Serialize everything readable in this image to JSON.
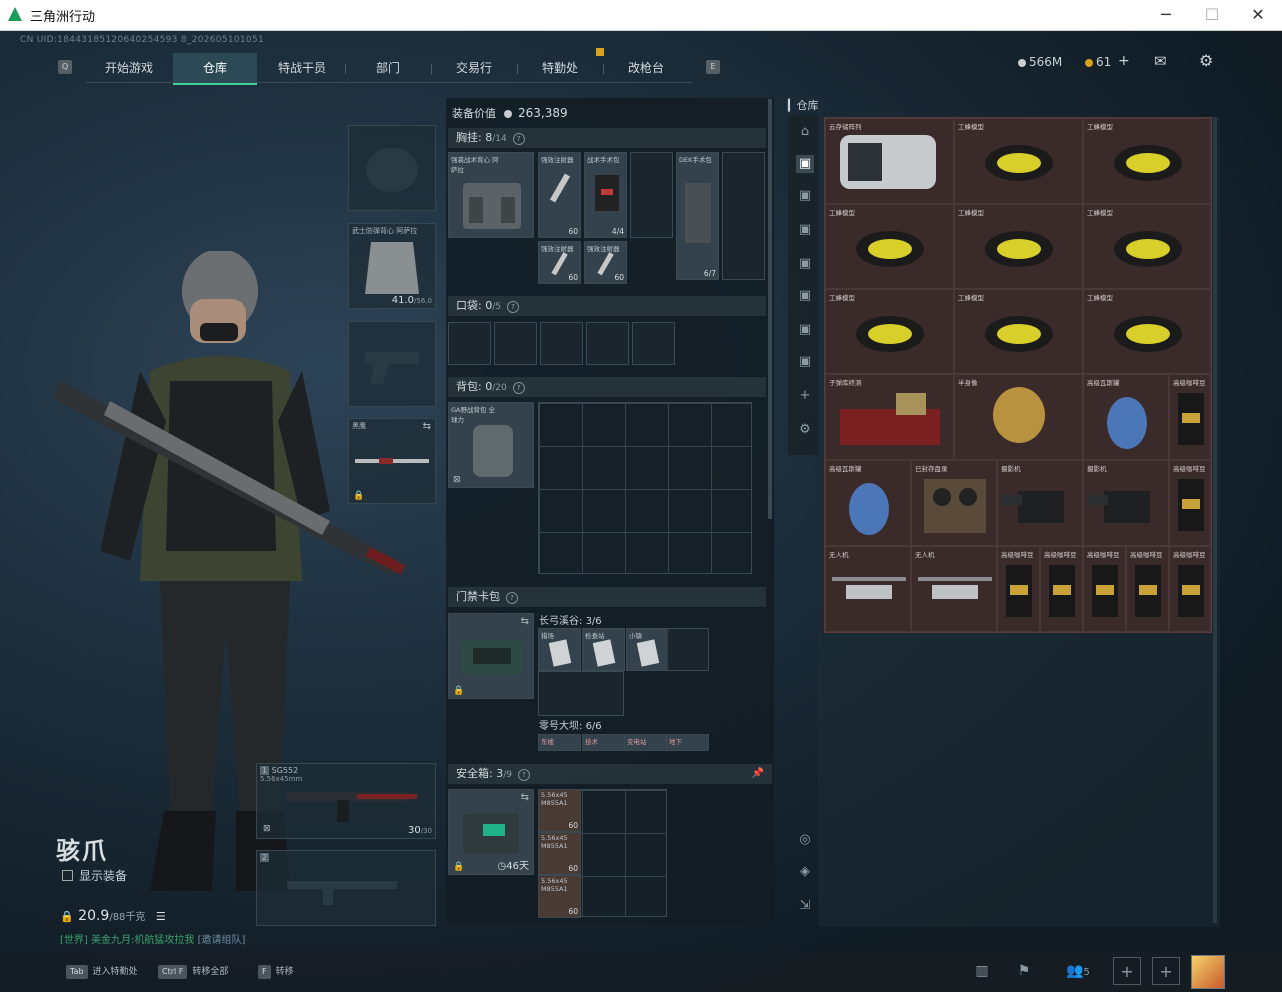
{
  "window": {
    "title": "三角洲行动",
    "minimize": "─",
    "maximize": "☐",
    "close": "✕"
  },
  "uid": "CN UID:18443185120640254593 8_202605101051",
  "nav": {
    "left_key": "Q",
    "right_key": "E",
    "tabs": [
      "开始游戏",
      "仓库",
      "特战干员",
      "部门",
      "交易行",
      "特勤处",
      "改枪台"
    ],
    "active_index": 1
  },
  "currency": {
    "silver": "566M",
    "gold": "61"
  },
  "character": {
    "name": "骇爪",
    "show_equipment": "显示装备",
    "weight": "20.9",
    "weight_max": "/88千克"
  },
  "chat": {
    "channel": "[世界]",
    "message": "美金九月:机航猛攻拉我",
    "invite": "[邀请组队]"
  },
  "slots": {
    "armor": {
      "label": "武士防弹背心 阿萨拉",
      "value": "41.0",
      "max": "/56.0"
    },
    "melee": {
      "label": "黑鹰"
    },
    "primary": {
      "index": "1",
      "name": "SG552",
      "caliber": "5.56x45mm",
      "ammo": "30",
      "ammo_max": "/30"
    },
    "secondary": {
      "index": "2"
    }
  },
  "equipment": {
    "value_label": "装备价值",
    "value": "263,389",
    "chest_rig": {
      "title": "胸挂:",
      "count": "8",
      "cap": "/14"
    },
    "chest_rig_item": "强袭战术背心 阿萨拉",
    "chest_items": [
      {
        "label": "强效注射器",
        "val": "60"
      },
      {
        "label": "战术手术包",
        "val": "4/4"
      },
      {
        "label": "DEK手术包",
        "val": "6/7"
      },
      {
        "label": "强效注射器",
        "val": "60"
      },
      {
        "label": "强效注射器",
        "val": "60"
      }
    ],
    "pocket": {
      "title": "口袋:",
      "count": "0",
      "cap": "/5"
    },
    "backpack": {
      "title": "背包:",
      "count": "0",
      "cap": "/20"
    },
    "backpack_item": "GA野战背包 全球力",
    "keycard": {
      "title": "门禁卡包"
    },
    "keycard_maps": [
      {
        "name": "长弓溪谷:",
        "count": "3/6",
        "cards": [
          "猎场",
          "检查站",
          "小镇"
        ]
      },
      {
        "name": "零号大坝:",
        "count": "6/6",
        "cards": [
          "东楼",
          "技术",
          "变电站",
          "地下"
        ]
      }
    ],
    "safe_box": {
      "title": "安全箱:",
      "count": "3",
      "cap": "/9",
      "days": "46天"
    },
    "safe_items": [
      {
        "label": "5.56x45 M855A1",
        "val": "60"
      },
      {
        "label": "5.56x45 M855A1",
        "val": "60"
      },
      {
        "label": "5.56x45 M855A1",
        "val": "60"
      }
    ]
  },
  "stash": {
    "title": "仓库",
    "items": [
      {
        "label": "云存储阵列"
      },
      {
        "label": "工蜂模型"
      },
      {
        "label": "工蜂模型"
      },
      {
        "label": "工蜂模型"
      },
      {
        "label": "工蜂模型"
      },
      {
        "label": "工蜂模型"
      },
      {
        "label": "工蜂模型"
      },
      {
        "label": "工蜂模型"
      },
      {
        "label": "工蜂模型"
      },
      {
        "label": "子弹库终测"
      },
      {
        "label": "半身像"
      },
      {
        "label": "高级瓦斯罐"
      },
      {
        "label": "高级咖啡豆"
      },
      {
        "label": "高级瓦斯罐"
      },
      {
        "label": "已封存盘录"
      },
      {
        "label": "摄影机"
      },
      {
        "label": "摄影机"
      },
      {
        "label": "高级咖啡豆"
      },
      {
        "label": "无人机"
      },
      {
        "label": "无人机"
      },
      {
        "label": "高级咖啡豆"
      },
      {
        "label": "高级咖啡豆"
      },
      {
        "label": "高级咖啡豆"
      },
      {
        "label": "高级咖啡豆"
      },
      {
        "label": "高级咖啡豆"
      }
    ]
  },
  "bottom": {
    "hints": [
      {
        "key": "Tab",
        "text": "进入特勤处"
      },
      {
        "key": "Ctrl F",
        "text": "转移全部"
      },
      {
        "key": "F",
        "text": "转移"
      }
    ],
    "squad_count": "5"
  },
  "colors": {
    "accent": "#3fcf9a",
    "stash_bg": "#3b2a2a",
    "badge": "#d8a21a"
  }
}
